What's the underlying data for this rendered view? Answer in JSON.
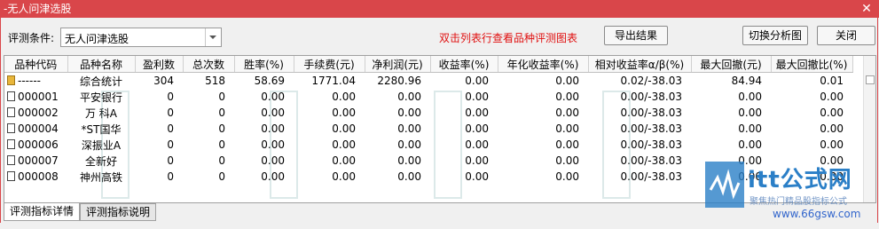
{
  "window": {
    "title": "-无人问津选股",
    "close_glyph": "✕"
  },
  "toolbar": {
    "condition_label": "评测条件:",
    "condition_value": "无人问津选股",
    "hint": "双击列表行查看品种评测图表",
    "export_label": "导出结果",
    "switch_label": "切换分析图",
    "close_label": "关闭"
  },
  "table": {
    "columns": [
      "品种代码",
      "品种名称",
      "盈利数",
      "总次数",
      "胜率(%)",
      "手续费(元)",
      "净利润(元)",
      "收益率(%)",
      "年化收益率(%)",
      "相对收益率α/β(%)",
      "最大回撤(元)",
      "最大回撤比(%)"
    ],
    "rows": [
      {
        "icon": "folder",
        "code": "------",
        "name": "综合统计",
        "profits": "304",
        "total": "518",
        "win": "58.69",
        "fee": "1771.04",
        "net": "2280.96",
        "ret": "0.00",
        "annual": "0.00",
        "alpha_beta": "0.02/-38.03",
        "maxdd": "84.94",
        "maxdd_pct": "0.01"
      },
      {
        "icon": "doc",
        "code": "000001",
        "name": "平安银行",
        "profits": "0",
        "total": "0",
        "win": "0.00",
        "fee": "0.00",
        "net": "0.00",
        "ret": "0.00",
        "annual": "0.00",
        "alpha_beta": "0.00/-38.03",
        "maxdd": "0.00",
        "maxdd_pct": "0.00"
      },
      {
        "icon": "doc",
        "code": "000002",
        "name": "万 科A",
        "profits": "0",
        "total": "0",
        "win": "0.00",
        "fee": "0.00",
        "net": "0.00",
        "ret": "0.00",
        "annual": "0.00",
        "alpha_beta": "0.00/-38.03",
        "maxdd": "0.00",
        "maxdd_pct": "0.00"
      },
      {
        "icon": "doc",
        "code": "000004",
        "name": "*ST国华",
        "profits": "0",
        "total": "0",
        "win": "0.00",
        "fee": "0.00",
        "net": "0.00",
        "ret": "0.00",
        "annual": "0.00",
        "alpha_beta": "0.00/-38.03",
        "maxdd": "0.00",
        "maxdd_pct": "0.00"
      },
      {
        "icon": "doc",
        "code": "000006",
        "name": "深振业A",
        "profits": "0",
        "total": "0",
        "win": "0.00",
        "fee": "0.00",
        "net": "0.00",
        "ret": "0.00",
        "annual": "0.00",
        "alpha_beta": "0.00/-38.03",
        "maxdd": "0.00",
        "maxdd_pct": "0.00"
      },
      {
        "icon": "doc",
        "code": "000007",
        "name": "全新好",
        "profits": "0",
        "total": "0",
        "win": "0.00",
        "fee": "0.00",
        "net": "0.00",
        "ret": "0.00",
        "annual": "0.00",
        "alpha_beta": "0.00/-38.03",
        "maxdd": "0.00",
        "maxdd_pct": "0.00"
      },
      {
        "icon": "doc",
        "code": "000008",
        "name": "神州高铁",
        "profits": "0",
        "total": "0",
        "win": "0.00",
        "fee": "0.00",
        "net": "0.00",
        "ret": "0.00",
        "annual": "0.00",
        "alpha_beta": "0.00/-38.03",
        "maxdd": "0.00",
        "maxdd_pct": "0.00"
      }
    ]
  },
  "tabs": [
    {
      "label": "评测指标详情",
      "active": true
    },
    {
      "label": "评测指标说明",
      "active": false
    }
  ],
  "brand": {
    "name": "itt公式网",
    "tagline": "聚焦热门精品股指标公式",
    "url": "www.66gsw.com",
    "color": "#2b7fc7"
  },
  "colors": {
    "titlebar": "#d9464a",
    "hint": "#e01010"
  }
}
